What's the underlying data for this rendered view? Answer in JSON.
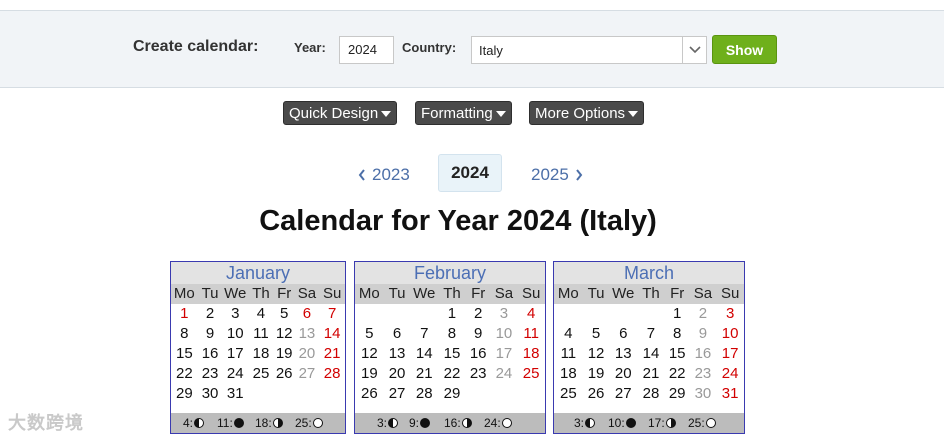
{
  "form": {
    "title": "Create calendar:",
    "year_label": "Year:",
    "year_value": "2024",
    "country_label": "Country:",
    "country_value": "Italy",
    "show_label": "Show"
  },
  "options": [
    "Quick Design",
    "Formatting",
    "More Options"
  ],
  "year_nav": {
    "prev": "2023",
    "current": "2024",
    "next": "2025"
  },
  "title": "Calendar for Year 2024 (Italy)",
  "weekdays": [
    "Mo",
    "Tu",
    "We",
    "Th",
    "Fr",
    "Sa",
    "Su"
  ],
  "months": [
    {
      "name": "January",
      "weeks": [
        [
          "1",
          "2",
          "3",
          "4",
          "5",
          "6",
          "7"
        ],
        [
          "8",
          "9",
          "10",
          "11",
          "12",
          "13",
          "14"
        ],
        [
          "15",
          "16",
          "17",
          "18",
          "19",
          "20",
          "21"
        ],
        [
          "22",
          "23",
          "24",
          "25",
          "26",
          "27",
          "28"
        ],
        [
          "29",
          "30",
          "31",
          "",
          "",
          "",
          ""
        ]
      ],
      "holidays": [
        "1",
        "6"
      ],
      "moons": [
        {
          "day": "4:",
          "phase": "last"
        },
        {
          "day": "11:",
          "phase": "new"
        },
        {
          "day": "18:",
          "phase": "first"
        },
        {
          "day": "25:",
          "phase": "full"
        }
      ]
    },
    {
      "name": "February",
      "weeks": [
        [
          "",
          "",
          "",
          "1",
          "2",
          "3",
          "4"
        ],
        [
          "5",
          "6",
          "7",
          "8",
          "9",
          "10",
          "11"
        ],
        [
          "12",
          "13",
          "14",
          "15",
          "16",
          "17",
          "18"
        ],
        [
          "19",
          "20",
          "21",
          "22",
          "23",
          "24",
          "25"
        ],
        [
          "26",
          "27",
          "28",
          "29",
          "",
          "",
          ""
        ]
      ],
      "holidays": [],
      "moons": [
        {
          "day": "3:",
          "phase": "last"
        },
        {
          "day": "9:",
          "phase": "new"
        },
        {
          "day": "16:",
          "phase": "first"
        },
        {
          "day": "24:",
          "phase": "full"
        }
      ]
    },
    {
      "name": "March",
      "weeks": [
        [
          "",
          "",
          "",
          "",
          "1",
          "2",
          "3"
        ],
        [
          "4",
          "5",
          "6",
          "7",
          "8",
          "9",
          "10"
        ],
        [
          "11",
          "12",
          "13",
          "14",
          "15",
          "16",
          "17"
        ],
        [
          "18",
          "19",
          "20",
          "21",
          "22",
          "23",
          "24"
        ],
        [
          "25",
          "26",
          "27",
          "28",
          "29",
          "30",
          "31"
        ]
      ],
      "holidays": [
        "31"
      ],
      "moons": [
        {
          "day": "3:",
          "phase": "last"
        },
        {
          "day": "10:",
          "phase": "new"
        },
        {
          "day": "17:",
          "phase": "first"
        },
        {
          "day": "25:",
          "phase": "full"
        }
      ]
    }
  ],
  "watermark": "大数跨境",
  "colors": {
    "accent": "#6fb01b",
    "link": "#4c6fa8",
    "month_title": "#4c6fb5",
    "holiday": "#d20000",
    "border": "#3a3ab0"
  }
}
